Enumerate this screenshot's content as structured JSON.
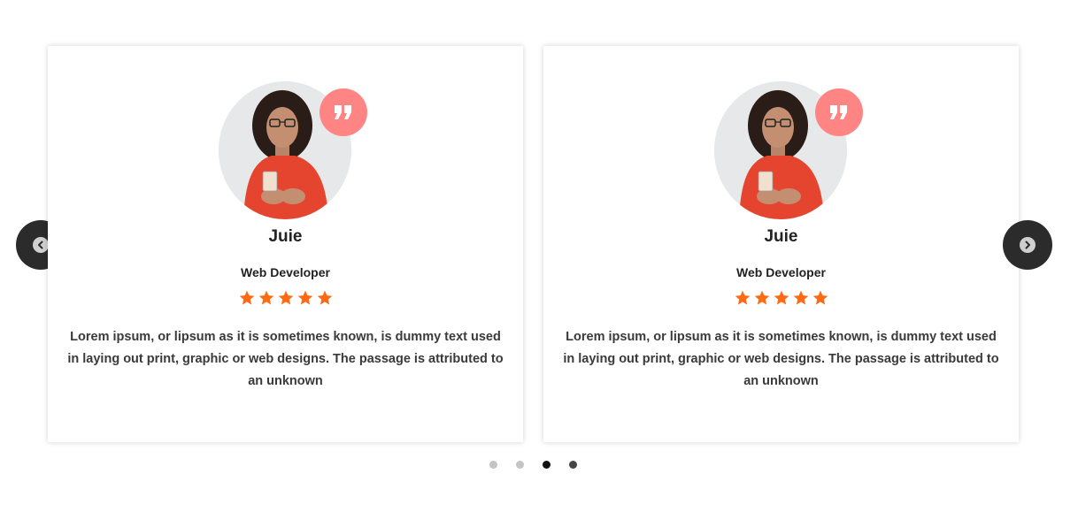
{
  "colors": {
    "quote_badge": "#ff8585",
    "star": "#ff6a13",
    "nav_button": "#2b2b2b",
    "dot_active": "#111111",
    "dot_inactive": "#c4c4c4"
  },
  "icons": {
    "prev": "chevron-left-icon",
    "next": "chevron-right-icon",
    "quote": "quote-icon",
    "star": "star-icon"
  },
  "testimonials": [
    {
      "name": "Juie",
      "role": "Web Developer",
      "rating": 5,
      "text": "Lorem ipsum, or lipsum as it is sometimes known, is dummy text used in laying out print, graphic or web designs. The passage is attributed to an unknown"
    },
    {
      "name": "Juie",
      "role": "Web Developer",
      "rating": 5,
      "text": "Lorem ipsum, or lipsum as it is sometimes known, is dummy text used in laying out print, graphic or web designs. The passage is attributed to an unknown"
    }
  ],
  "pagination": {
    "total": 4,
    "active_index": 2
  }
}
